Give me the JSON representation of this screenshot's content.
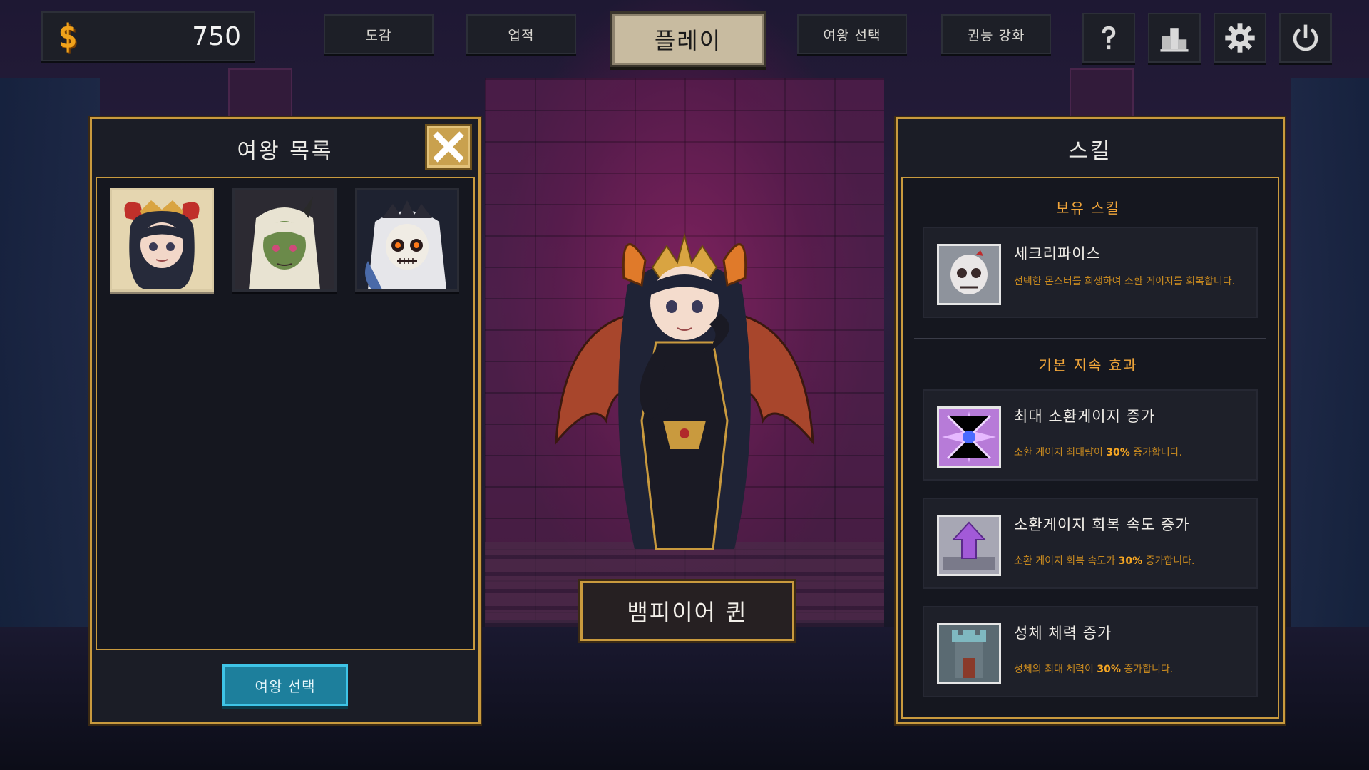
{
  "currency": {
    "symbol": "$",
    "amount": "750"
  },
  "topnav": {
    "collection": "도감",
    "achievements": "업적",
    "play": "플레이",
    "queen_select": "여왕 선택",
    "ability_upgrade": "권능 강화"
  },
  "icons": {
    "help": "question-icon",
    "ranking": "podium-icon",
    "settings": "gear-icon",
    "power": "power-icon",
    "close": "close-icon"
  },
  "queen_list": {
    "title": "여왕 목록",
    "portraits": [
      {
        "name": "demon-queen-portrait",
        "selected": true
      },
      {
        "name": "orc-queen-portrait",
        "selected": false
      },
      {
        "name": "skeleton-queen-portrait",
        "selected": false
      }
    ],
    "select_button": "여왕 선택"
  },
  "character": {
    "name": "뱀피이어 퀸"
  },
  "skills": {
    "title": "스킬",
    "owned_label": "보유 스킬",
    "owned": [
      {
        "name": "세크리파이스",
        "desc": "선택한 몬스터를 희생하여 소환 게이지를 회복합니다.",
        "icon": "skull-icon"
      }
    ],
    "passive_label": "기본 지속 효과",
    "passives": [
      {
        "name": "최대 소환게이지 증가",
        "desc_pre": "소환 게이지 최대량이 ",
        "highlight": "30%",
        "desc_post": " 증가합니다.",
        "icon": "crystal-burst-icon"
      },
      {
        "name": "소환게이지 회복 속도 증가",
        "desc_pre": "소환 게이지 회복 속도가 ",
        "highlight": "30%",
        "desc_post": " 증가합니다.",
        "icon": "upgrade-arrow-icon"
      },
      {
        "name": "성체 체력 증가",
        "desc_pre": "성체의 최대 체력이 ",
        "highlight": "30%",
        "desc_post": " 증가합니다.",
        "icon": "castle-tower-icon"
      }
    ]
  },
  "colors": {
    "gold_border": "#c99a3e",
    "accent_orange": "#f0a53a",
    "select_blue": "#1d7f9c"
  }
}
